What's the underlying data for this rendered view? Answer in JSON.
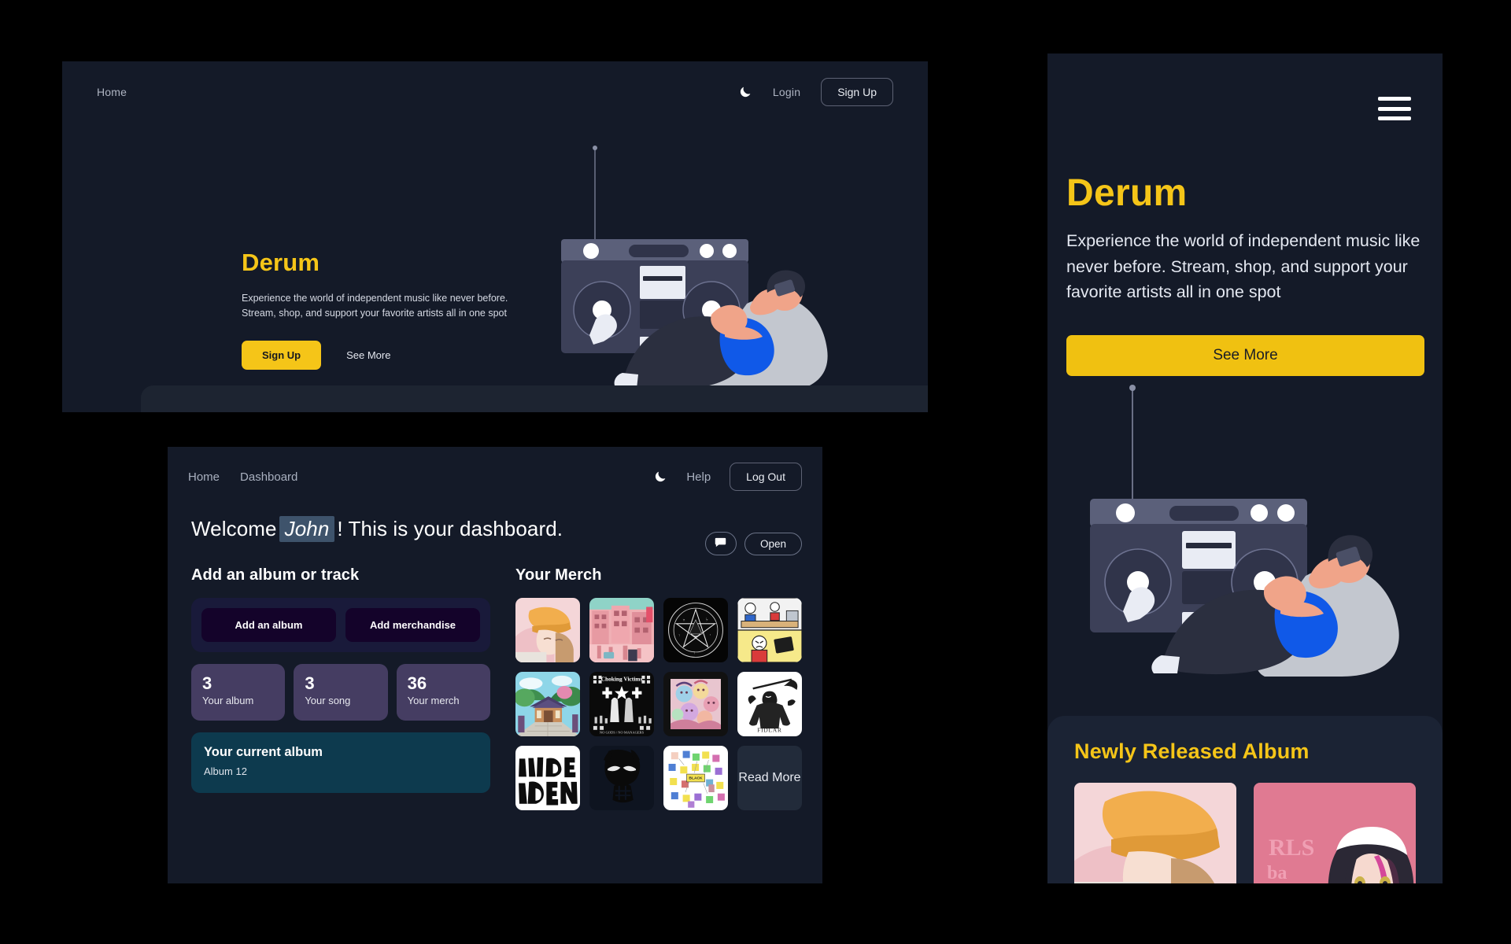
{
  "hero": {
    "nav": {
      "home_label": "Home",
      "theme_toggle_icon": "moon-icon",
      "login_label": "Login",
      "signup_label": "Sign Up"
    },
    "title": "Derum",
    "subtitle": "Experience the world of independent music like never before. Stream, shop, and support your favorite artists all in one spot",
    "primary_cta": "Sign Up",
    "secondary_cta": "See More",
    "illustration": "boombox-listener-illustration"
  },
  "dashboard": {
    "nav": {
      "home_label": "Home",
      "dashboard_label": "Dashboard",
      "theme_toggle_icon": "moon-icon",
      "help_label": "Help",
      "logout_label": "Log Out"
    },
    "welcome": {
      "prefix": "Welcome",
      "username": "John",
      "suffix": "! This is your dashboard."
    },
    "add_section": {
      "title": "Add an album or track",
      "add_album_label": "Add an album",
      "add_merch_label": "Add merchandise"
    },
    "stats": [
      {
        "value": "3",
        "label": "Your album"
      },
      {
        "value": "3",
        "label": "Your song"
      },
      {
        "value": "36",
        "label": "Your merch"
      }
    ],
    "current_album": {
      "title": "Your current album",
      "value": "Album 12"
    },
    "merch": {
      "title": "Your Merch",
      "chat_icon": "chat-bubble-icon",
      "open_label": "Open",
      "read_more_label": "Read More",
      "tiles": [
        "anime-girl-yellow-hat-cover",
        "pink-cityscape-cover",
        "black-pentagram-sigil-cover",
        "comic-strip-meme-cover",
        "anime-shrine-landscape-cover",
        "choking-victims-band-cover",
        "anime-collage-cover",
        "grim-reaper-fidlar-cover",
        "lucid-dendl-typography-cover",
        "misfits-skull-cover",
        "sticky-notes-board-cover"
      ]
    }
  },
  "mobile": {
    "menu_icon": "hamburger-menu-icon",
    "title": "Derum",
    "subtitle": "Experience the world of independent music like never before. Stream, shop, and support your favorite artists all in one spot",
    "cta_label": "See More",
    "illustration": "boombox-listener-illustration",
    "section_title": "Newly Released Album",
    "albums": [
      "anime-girl-yellow-hat-cover",
      "anime-girl-pink-headband-cover"
    ]
  },
  "colors": {
    "page_background": "#000000",
    "panel_background": "#141a28",
    "panel_background_alt": "#1b2334",
    "accent_yellow": "#f5c518",
    "stat_purple": "#453d62",
    "teal_card": "#0d3a4e",
    "add_box_indigo": "#191a3a",
    "add_button_dark": "#14032a",
    "text_primary": "#ffffff",
    "text_muted": "#aeb4c2"
  }
}
